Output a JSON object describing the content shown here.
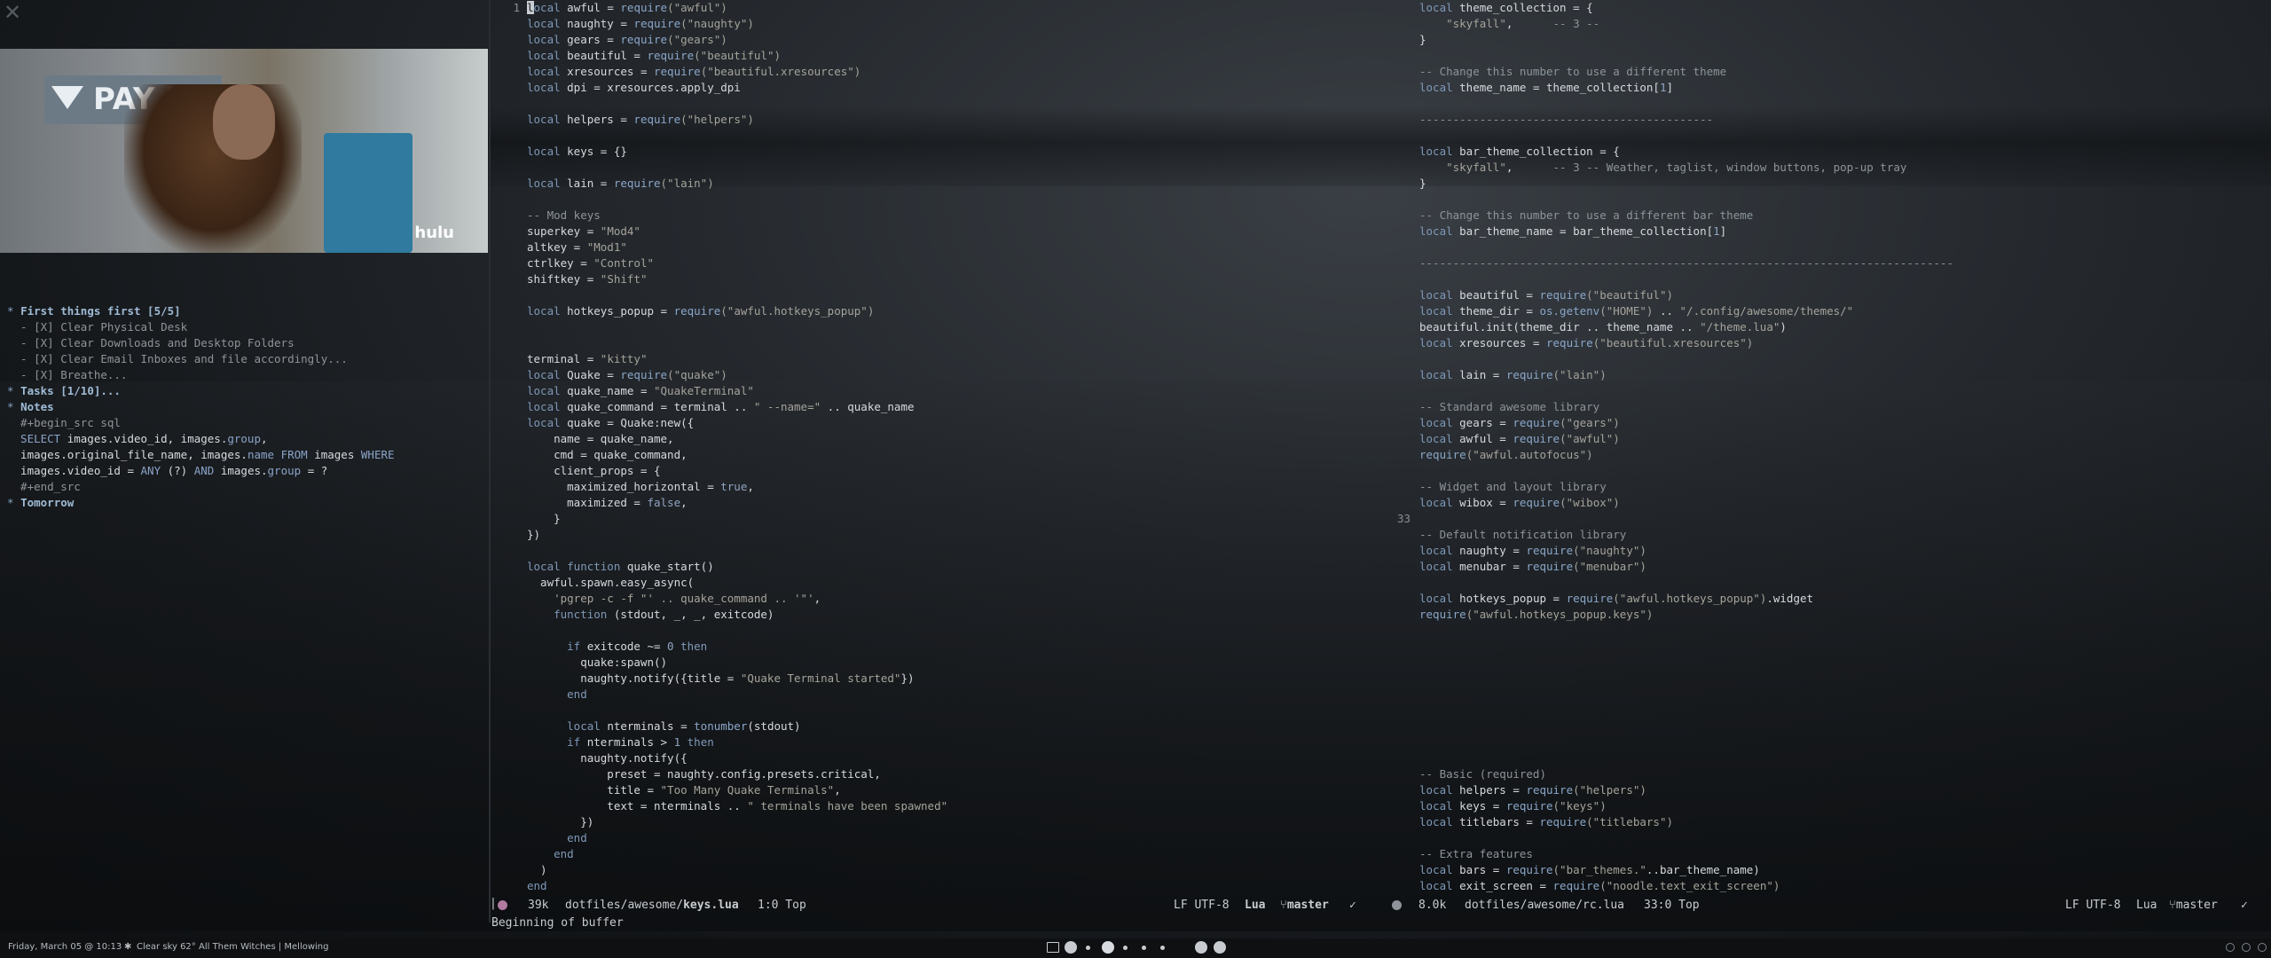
{
  "left_panel": {
    "close_glyph": "✕",
    "video_overlay": {
      "sign_text": "PAY HER",
      "logo": "hulu"
    },
    "org_lines": [
      [
        {
          "t": "* ",
          "c": "star"
        },
        {
          "t": "First things first [5/5]",
          "c": "heading"
        }
      ],
      [
        {
          "t": "  - [X] Clear Physical Desk",
          "c": "dim"
        }
      ],
      [
        {
          "t": "  - [X] Clear Downloads and Desktop Folders",
          "c": "dim"
        }
      ],
      [
        {
          "t": "  - [X] Clear Email Inboxes and file accordingly...",
          "c": "dim"
        }
      ],
      [
        {
          "t": "  - [X] Breathe...",
          "c": "dim"
        }
      ],
      [
        {
          "t": "* ",
          "c": "star"
        },
        {
          "t": "Tasks [1/10]...",
          "c": "heading"
        }
      ],
      [
        {
          "t": "* ",
          "c": "star"
        },
        {
          "t": "Notes",
          "c": "heading"
        }
      ],
      [
        {
          "t": "  #+begin_src sql",
          "c": "dim"
        }
      ],
      [
        {
          "t": "  SELECT ",
          "c": "kw"
        },
        {
          "t": "images.video_id, images.",
          "c": "t"
        },
        {
          "t": "group",
          "c": "kw"
        },
        {
          "t": ",",
          "c": "t"
        }
      ],
      [
        {
          "t": "  images.original_file_name, images.",
          "c": "t"
        },
        {
          "t": "name FROM ",
          "c": "kw"
        },
        {
          "t": "images ",
          "c": "t"
        },
        {
          "t": "WHERE",
          "c": "kw"
        }
      ],
      [
        {
          "t": "  images.video_id = ",
          "c": "t"
        },
        {
          "t": "ANY",
          "c": "kw"
        },
        {
          "t": " (?) ",
          "c": "t"
        },
        {
          "t": "AND",
          "c": "kw"
        },
        {
          "t": " images.",
          "c": "t"
        },
        {
          "t": "group",
          "c": "kw"
        },
        {
          "t": " = ?",
          "c": "t"
        }
      ],
      [
        {
          "t": "  #+end_src",
          "c": "dim"
        }
      ],
      [
        {
          "t": "* ",
          "c": "star"
        },
        {
          "t": "Tomorrow",
          "c": "heading"
        }
      ]
    ]
  },
  "left_editor": {
    "gutter_line": "1",
    "lines": [
      [
        {
          "t": "l",
          "c": "cursor"
        },
        {
          "t": "ocal ",
          "c": "k"
        },
        {
          "t": "awful = ",
          "c": "t"
        },
        {
          "t": "require",
          "c": "f"
        },
        {
          "t": "(\"awful\")",
          "c": "s"
        }
      ],
      [
        {
          "t": "local ",
          "c": "k"
        },
        {
          "t": "naughty = ",
          "c": "t"
        },
        {
          "t": "require",
          "c": "f"
        },
        {
          "t": "(\"naughty\")",
          "c": "s"
        }
      ],
      [
        {
          "t": "local ",
          "c": "k"
        },
        {
          "t": "gears = ",
          "c": "t"
        },
        {
          "t": "require",
          "c": "f"
        },
        {
          "t": "(\"gears\")",
          "c": "s"
        }
      ],
      [
        {
          "t": "local ",
          "c": "k"
        },
        {
          "t": "beautiful = ",
          "c": "t"
        },
        {
          "t": "require",
          "c": "f"
        },
        {
          "t": "(\"beautiful\")",
          "c": "s"
        }
      ],
      [
        {
          "t": "local ",
          "c": "k"
        },
        {
          "t": "xresources = ",
          "c": "t"
        },
        {
          "t": "require",
          "c": "f"
        },
        {
          "t": "(\"beautiful.xresources\")",
          "c": "s"
        }
      ],
      [
        {
          "t": "local ",
          "c": "k"
        },
        {
          "t": "dpi = xresources.apply_dpi",
          "c": "t"
        }
      ],
      [],
      [
        {
          "t": "local ",
          "c": "k"
        },
        {
          "t": "helpers = ",
          "c": "t"
        },
        {
          "t": "require",
          "c": "f"
        },
        {
          "t": "(\"helpers\")",
          "c": "s"
        }
      ],
      [],
      [
        {
          "t": "local ",
          "c": "k"
        },
        {
          "t": "keys = {}",
          "c": "t"
        }
      ],
      [],
      [
        {
          "t": "local ",
          "c": "k"
        },
        {
          "t": "lain = ",
          "c": "t"
        },
        {
          "t": "require",
          "c": "f"
        },
        {
          "t": "(\"lain\")",
          "c": "s"
        }
      ],
      [],
      [
        {
          "t": "-- Mod keys",
          "c": "c"
        }
      ],
      [
        {
          "t": "superkey = ",
          "c": "t"
        },
        {
          "t": "\"Mod4\"",
          "c": "s"
        }
      ],
      [
        {
          "t": "altkey = ",
          "c": "t"
        },
        {
          "t": "\"Mod1\"",
          "c": "s"
        }
      ],
      [
        {
          "t": "ctrlkey = ",
          "c": "t"
        },
        {
          "t": "\"Control\"",
          "c": "s"
        }
      ],
      [
        {
          "t": "shiftkey = ",
          "c": "t"
        },
        {
          "t": "\"Shift\"",
          "c": "s"
        }
      ],
      [],
      [
        {
          "t": "local ",
          "c": "k"
        },
        {
          "t": "hotkeys_popup = ",
          "c": "t"
        },
        {
          "t": "require",
          "c": "f"
        },
        {
          "t": "(\"awful.hotkeys_popup\")",
          "c": "s"
        }
      ],
      [],
      [],
      [
        {
          "t": "terminal = ",
          "c": "t"
        },
        {
          "t": "\"kitty\"",
          "c": "s"
        }
      ],
      [
        {
          "t": "local ",
          "c": "k"
        },
        {
          "t": "Quake = ",
          "c": "t"
        },
        {
          "t": "require",
          "c": "f"
        },
        {
          "t": "(\"quake\")",
          "c": "s"
        }
      ],
      [
        {
          "t": "local ",
          "c": "k"
        },
        {
          "t": "quake_name = ",
          "c": "t"
        },
        {
          "t": "\"QuakeTerminal\"",
          "c": "s"
        }
      ],
      [
        {
          "t": "local ",
          "c": "k"
        },
        {
          "t": "quake_command = terminal .. ",
          "c": "t"
        },
        {
          "t": "\" --name=\"",
          "c": "s"
        },
        {
          "t": " .. quake_name",
          "c": "t"
        }
      ],
      [
        {
          "t": "local ",
          "c": "k"
        },
        {
          "t": "quake = Quake:new({",
          "c": "t"
        }
      ],
      [
        {
          "t": "    name = quake_name,",
          "c": "t"
        }
      ],
      [
        {
          "t": "    cmd = quake_command,",
          "c": "t"
        }
      ],
      [
        {
          "t": "    client_props = {",
          "c": "t"
        }
      ],
      [
        {
          "t": "      maximized_horizontal = ",
          "c": "t"
        },
        {
          "t": "true",
          "c": "n"
        },
        {
          "t": ",",
          "c": "t"
        }
      ],
      [
        {
          "t": "      maximized = ",
          "c": "t"
        },
        {
          "t": "false",
          "c": "n"
        },
        {
          "t": ",",
          "c": "t"
        }
      ],
      [
        {
          "t": "    }",
          "c": "t"
        }
      ],
      [
        {
          "t": "})",
          "c": "t"
        }
      ],
      [],
      [
        {
          "t": "local function ",
          "c": "k"
        },
        {
          "t": "quake_start()",
          "c": "t"
        }
      ],
      [
        {
          "t": "  awful.spawn.easy_async(",
          "c": "t"
        }
      ],
      [
        {
          "t": "    'pgrep -c -f \"' .. quake_command .. '\"'",
          "c": "s"
        },
        {
          "t": ",",
          "c": "t"
        }
      ],
      [
        {
          "t": "    function ",
          "c": "k"
        },
        {
          "t": "(stdout, _, _, exitcode)",
          "c": "t"
        }
      ],
      [],
      [
        {
          "t": "      if ",
          "c": "k"
        },
        {
          "t": "exitcode ~= ",
          "c": "t"
        },
        {
          "t": "0 ",
          "c": "n"
        },
        {
          "t": "then",
          "c": "k"
        }
      ],
      [
        {
          "t": "        quake:spawn()",
          "c": "t"
        }
      ],
      [
        {
          "t": "        naughty.notify({title = ",
          "c": "t"
        },
        {
          "t": "\"Quake Terminal started\"",
          "c": "s"
        },
        {
          "t": "})",
          "c": "t"
        }
      ],
      [
        {
          "t": "      end",
          "c": "k"
        }
      ],
      [],
      [
        {
          "t": "      local ",
          "c": "k"
        },
        {
          "t": "nterminals = ",
          "c": "t"
        },
        {
          "t": "tonumber",
          "c": "f"
        },
        {
          "t": "(stdout)",
          "c": "t"
        }
      ],
      [
        {
          "t": "      if ",
          "c": "k"
        },
        {
          "t": "nterminals > ",
          "c": "t"
        },
        {
          "t": "1 ",
          "c": "n"
        },
        {
          "t": "then",
          "c": "k"
        }
      ],
      [
        {
          "t": "        naughty.notify({",
          "c": "t"
        }
      ],
      [
        {
          "t": "            preset = naughty.config.presets.critical,",
          "c": "t"
        }
      ],
      [
        {
          "t": "            title = ",
          "c": "t"
        },
        {
          "t": "\"Too Many Quake Terminals\"",
          "c": "s"
        },
        {
          "t": ",",
          "c": "t"
        }
      ],
      [
        {
          "t": "            text = nterminals .. ",
          "c": "t"
        },
        {
          "t": "\" terminals have been spawned\"",
          "c": "s"
        }
      ],
      [
        {
          "t": "        })",
          "c": "t"
        }
      ],
      [
        {
          "t": "      end",
          "c": "k"
        }
      ],
      [
        {
          "t": "    end",
          "c": "k"
        }
      ],
      [
        {
          "t": "  )",
          "c": "t"
        }
      ],
      [
        {
          "t": "end",
          "c": "k"
        }
      ]
    ]
  },
  "right_editor": {
    "gutter_line": "33",
    "lines": [
      [
        {
          "t": "local ",
          "c": "k"
        },
        {
          "t": "theme_collection = {",
          "c": "t"
        }
      ],
      [
        {
          "t": "    ",
          "c": "t"
        },
        {
          "t": "\"skyfall\"",
          "c": "s"
        },
        {
          "t": ",      ",
          "c": "t"
        },
        {
          "t": "-- 3 --",
          "c": "c"
        }
      ],
      [
        {
          "t": "}",
          "c": "t"
        }
      ],
      [],
      [
        {
          "t": "-- Change this number to use a different theme",
          "c": "c"
        }
      ],
      [
        {
          "t": "local ",
          "c": "k"
        },
        {
          "t": "theme_name = theme_collection[",
          "c": "t"
        },
        {
          "t": "1",
          "c": "n"
        },
        {
          "t": "]",
          "c": "t"
        }
      ],
      [],
      [
        {
          "t": "--------------------------------------------",
          "c": "c"
        }
      ],
      [],
      [
        {
          "t": "local ",
          "c": "k"
        },
        {
          "t": "bar_theme_collection = {",
          "c": "t"
        }
      ],
      [
        {
          "t": "    ",
          "c": "t"
        },
        {
          "t": "\"skyfall\"",
          "c": "s"
        },
        {
          "t": ",      ",
          "c": "t"
        },
        {
          "t": "-- 3 -- Weather, taglist, window buttons, pop-up tray",
          "c": "c"
        }
      ],
      [
        {
          "t": "}",
          "c": "t"
        }
      ],
      [],
      [
        {
          "t": "-- Change this number to use a different bar theme",
          "c": "c"
        }
      ],
      [
        {
          "t": "local ",
          "c": "k"
        },
        {
          "t": "bar_theme_name = bar_theme_collection[",
          "c": "t"
        },
        {
          "t": "1",
          "c": "n"
        },
        {
          "t": "]",
          "c": "t"
        }
      ],
      [],
      [
        {
          "t": "--------------------------------------------------------------------------------",
          "c": "c"
        }
      ],
      [],
      [
        {
          "t": "local ",
          "c": "k"
        },
        {
          "t": "beautiful = ",
          "c": "t"
        },
        {
          "t": "require",
          "c": "f"
        },
        {
          "t": "(\"beautiful\")",
          "c": "s"
        }
      ],
      [
        {
          "t": "local ",
          "c": "k"
        },
        {
          "t": "theme_dir = ",
          "c": "t"
        },
        {
          "t": "os.getenv",
          "c": "f"
        },
        {
          "t": "(\"HOME\")",
          "c": "s"
        },
        {
          "t": " .. ",
          "c": "t"
        },
        {
          "t": "\"/.config/awesome/themes/\"",
          "c": "s"
        }
      ],
      [
        {
          "t": "beautiful.init(theme_dir .. theme_name .. ",
          "c": "t"
        },
        {
          "t": "\"/theme.lua\"",
          "c": "s"
        },
        {
          "t": ")",
          "c": "t"
        }
      ],
      [
        {
          "t": "local ",
          "c": "k"
        },
        {
          "t": "xresources = ",
          "c": "t"
        },
        {
          "t": "require",
          "c": "f"
        },
        {
          "t": "(\"beautiful.xresources\")",
          "c": "s"
        }
      ],
      [],
      [
        {
          "t": "local ",
          "c": "k"
        },
        {
          "t": "lain = ",
          "c": "t"
        },
        {
          "t": "require",
          "c": "f"
        },
        {
          "t": "(\"lain\")",
          "c": "s"
        }
      ],
      [],
      [
        {
          "t": "-- Standard awesome library",
          "c": "c"
        }
      ],
      [
        {
          "t": "local ",
          "c": "k"
        },
        {
          "t": "gears = ",
          "c": "t"
        },
        {
          "t": "require",
          "c": "f"
        },
        {
          "t": "(\"gears\")",
          "c": "s"
        }
      ],
      [
        {
          "t": "local ",
          "c": "k"
        },
        {
          "t": "awful = ",
          "c": "t"
        },
        {
          "t": "require",
          "c": "f"
        },
        {
          "t": "(\"awful\")",
          "c": "s"
        }
      ],
      [
        {
          "t": "require",
          "c": "f"
        },
        {
          "t": "(\"awful.autofocus\")",
          "c": "s"
        }
      ],
      [],
      [
        {
          "t": "-- Widget and layout library",
          "c": "c"
        }
      ],
      [
        {
          "t": "local ",
          "c": "k"
        },
        {
          "t": "wibox = ",
          "c": "t"
        },
        {
          "t": "require",
          "c": "f"
        },
        {
          "t": "(\"wibox\")",
          "c": "s"
        }
      ],
      [],
      [
        {
          "t": "-- Default notification library",
          "c": "c"
        }
      ],
      [
        {
          "t": "local ",
          "c": "k"
        },
        {
          "t": "naughty = ",
          "c": "t"
        },
        {
          "t": "require",
          "c": "f"
        },
        {
          "t": "(\"naughty\")",
          "c": "s"
        }
      ],
      [
        {
          "t": "local ",
          "c": "k"
        },
        {
          "t": "menubar = ",
          "c": "t"
        },
        {
          "t": "require",
          "c": "f"
        },
        {
          "t": "(\"menubar\")",
          "c": "s"
        }
      ],
      [],
      [
        {
          "t": "local ",
          "c": "k"
        },
        {
          "t": "hotkeys_popup = ",
          "c": "t"
        },
        {
          "t": "require",
          "c": "f"
        },
        {
          "t": "(\"awful.hotkeys_popup\")",
          "c": "s"
        },
        {
          "t": ".widget",
          "c": "t"
        }
      ],
      [
        {
          "t": "require",
          "c": "f"
        },
        {
          "t": "(\"awful.hotkeys_popup.keys\")",
          "c": "s"
        }
      ],
      [],
      [],
      [],
      [],
      [],
      [],
      [],
      [],
      [],
      [
        {
          "t": "-- Basic (required)",
          "c": "c"
        }
      ],
      [
        {
          "t": "local ",
          "c": "k"
        },
        {
          "t": "helpers = ",
          "c": "t"
        },
        {
          "t": "require",
          "c": "f"
        },
        {
          "t": "(\"helpers\")",
          "c": "s"
        }
      ],
      [
        {
          "t": "local ",
          "c": "k"
        },
        {
          "t": "keys = ",
          "c": "t"
        },
        {
          "t": "require",
          "c": "f"
        },
        {
          "t": "(\"keys\")",
          "c": "s"
        }
      ],
      [
        {
          "t": "local ",
          "c": "k"
        },
        {
          "t": "titlebars = ",
          "c": "t"
        },
        {
          "t": "require",
          "c": "f"
        },
        {
          "t": "(\"titlebars\")",
          "c": "s"
        }
      ],
      [],
      [
        {
          "t": "-- Extra features",
          "c": "c"
        }
      ],
      [
        {
          "t": "local ",
          "c": "k"
        },
        {
          "t": "bars = ",
          "c": "t"
        },
        {
          "t": "require",
          "c": "f"
        },
        {
          "t": "(\"bar_themes.\"",
          "c": "s"
        },
        {
          "t": "..bar_theme_name)",
          "c": "t"
        }
      ],
      [
        {
          "t": "local ",
          "c": "k"
        },
        {
          "t": "exit_screen = ",
          "c": "t"
        },
        {
          "t": "require",
          "c": "f"
        },
        {
          "t": "(\"noodle.text_exit_screen\")",
          "c": "s"
        }
      ]
    ]
  },
  "modeline_left": {
    "size": "39k",
    "path_dir": "dotfiles/awesome/",
    "path_file": "keys.lua",
    "position": "1:0 Top",
    "encoding": "LF UTF-8",
    "mode": "Lua",
    "branch": "master",
    "check": "✓"
  },
  "modeline_right": {
    "size": "8.0k",
    "path": "dotfiles/awesome/rc.lua",
    "position": "33:0 Top",
    "encoding": "LF UTF-8",
    "mode": "Lua",
    "branch": "master",
    "check": "✓"
  },
  "echo_area": "Beginning of buffer",
  "status_bar": {
    "date": "Friday, March 05 @ 10:13",
    "weather_icon": "✱",
    "weather": "Clear sky 62°",
    "now_playing": "All Them Witches | Mellowing"
  },
  "colors": {
    "modeline_dot": "#b07aa1",
    "accent": "#8aa3c8"
  }
}
